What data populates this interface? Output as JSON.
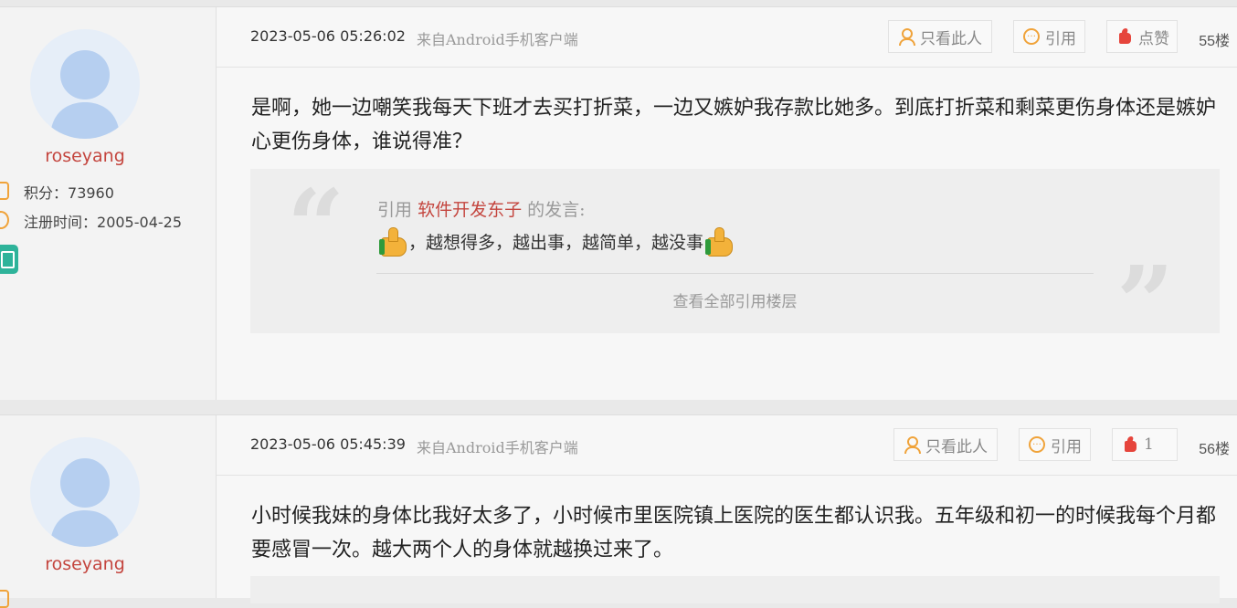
{
  "posts": [
    {
      "user": {
        "name": "roseyang",
        "points_label": "积分：",
        "points": "73960",
        "reg_label": "注册时间：",
        "reg_date": "2005-04-25"
      },
      "date": "2023-05-06 05:26:02",
      "source": "来自Android手机客户端",
      "buttons": {
        "only_this": "只看此人",
        "quote": "引用",
        "like": "点赞"
      },
      "floor": "55楼",
      "text": "是啊，她一边嘲笑我每天下班才去买打折菜，一边又嫉妒我存款比她多。到底打折菜和剩菜更伤身体还是嫉妒心更伤身体，谁说得准？",
      "quote": {
        "prefix": "引用",
        "author": "软件开发东子",
        "suffix": "的发言:",
        "text": "，越想得多，越出事，越简单，越没事",
        "more": "查看全部引用楼层"
      }
    },
    {
      "user": {
        "name": "roseyang"
      },
      "date": "2023-05-06 05:45:39",
      "source": "来自Android手机客户端",
      "buttons": {
        "only_this": "只看此人",
        "quote": "引用",
        "like": "1"
      },
      "floor": "56楼",
      "text": "小时候我妹的身体比我好太多了，小时候市里医院镇上医院的医生都认识我。五年级和初一的时候我每个月都要感冒一次。越大两个人的身体就越换过来了。"
    }
  ],
  "colors": {
    "username": "#c4453e",
    "accent": "#f0a33a",
    "like": "#e6453c"
  },
  "icons": [
    "coin-icon",
    "clock-icon",
    "tablet-icon",
    "person-icon",
    "quote-icon",
    "like-icon",
    "thumbs-up-emoji"
  ]
}
